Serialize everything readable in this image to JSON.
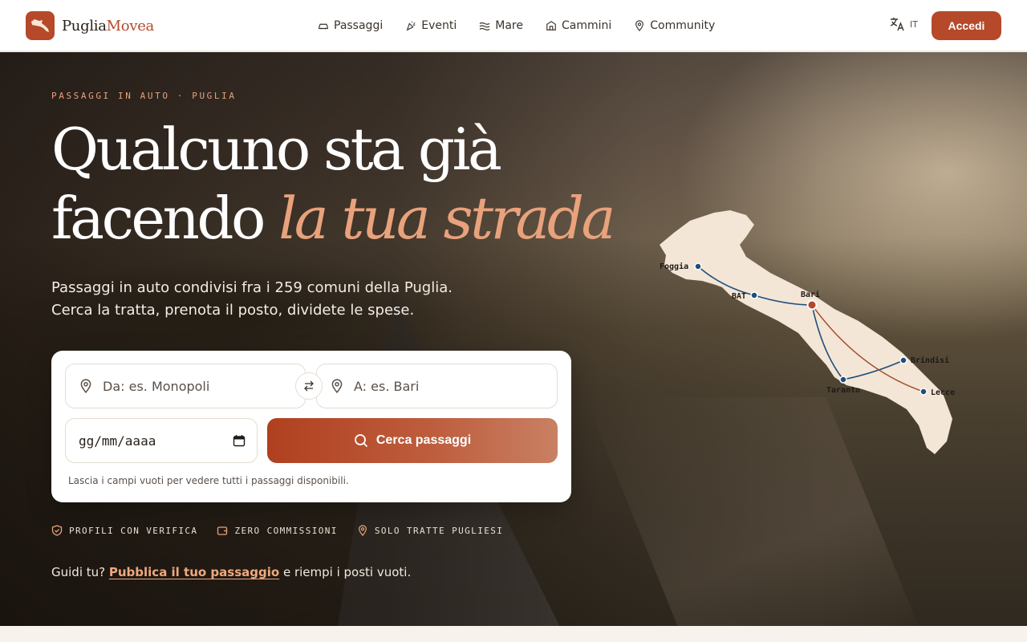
{
  "brand": {
    "name_part1": "Puglia",
    "name_part2": "Movea"
  },
  "nav": [
    {
      "label": "Passaggi",
      "icon": "car-icon"
    },
    {
      "label": "Eventi",
      "icon": "party-icon"
    },
    {
      "label": "Mare",
      "icon": "waves-icon"
    },
    {
      "label": "Cammini",
      "icon": "building-icon"
    },
    {
      "label": "Community",
      "icon": "pin-icon"
    }
  ],
  "language": {
    "code": "IT",
    "icon": "translate-icon"
  },
  "login_label": "Accedi",
  "hero": {
    "eyebrow": "PASSAGGI IN AUTO · PUGLIA",
    "title_line1": "Qualcuno sta già",
    "title_line2_plain": "facendo ",
    "title_line2_accent": "la tua strada",
    "subtitle_line1": "Passaggi in auto condivisi fra i 259 comuni della Puglia.",
    "subtitle_line2": "Cerca la tratta, prenota il posto, dividete le spese."
  },
  "search": {
    "from_placeholder": "Da: es. Monopoli",
    "to_placeholder": "A: es. Bari",
    "date_placeholder": "gg/mm/aaaa",
    "button_label": "Cerca passaggi",
    "hint": "Lascia i campi vuoti per vedere tutti i passaggi disponibili."
  },
  "badges": [
    {
      "label": "PROFILI CON VERIFICA",
      "icon": "shield-icon"
    },
    {
      "label": "ZERO COMMISSIONI",
      "icon": "wallet-icon"
    },
    {
      "label": "SOLO TRATTE PUGLIESI",
      "icon": "pin-icon"
    }
  ],
  "cta": {
    "prefix": "Guidi tu? ",
    "link": "Pubblica il tuo passaggio",
    "suffix": " e riempi i posti vuoti."
  },
  "map": {
    "cities": [
      "Foggia",
      "BAT",
      "Bari",
      "Brindisi",
      "Taranto",
      "Lecce"
    ]
  },
  "colors": {
    "accent": "#b5492a",
    "accent_light": "#e9a27c",
    "route_blue": "#1e4f7a"
  }
}
